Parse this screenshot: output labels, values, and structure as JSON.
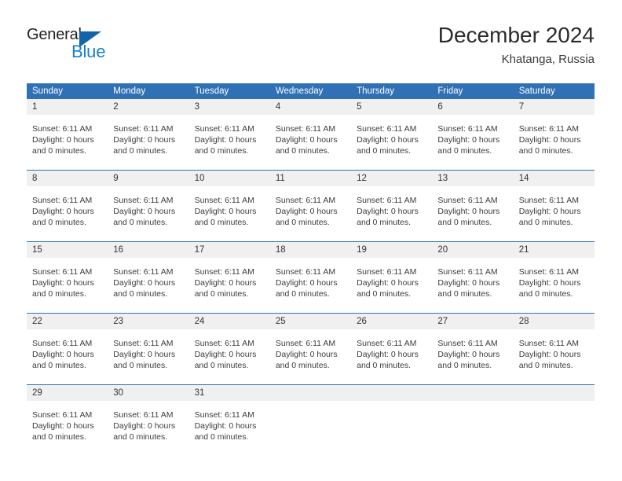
{
  "brand": {
    "name_part1": "General",
    "name_part2": "Blue",
    "triangle_icon": "triangle-right-icon",
    "colors": {
      "general_text": "#231f20",
      "blue_text": "#1a7fc8",
      "triangle": "#1464aa"
    }
  },
  "header": {
    "title": "December 2024",
    "location": "Khatanga, Russia"
  },
  "theme": {
    "header_bg": "#2f71b4",
    "header_text": "#ffffff",
    "date_band_bg": "#f0f0f0",
    "rule_color": "#2f71b4",
    "body_text": "#3c3c3c"
  },
  "calendar": {
    "weekdays": [
      "Sunday",
      "Monday",
      "Tuesday",
      "Wednesday",
      "Thursday",
      "Friday",
      "Saturday"
    ],
    "weeks": [
      {
        "days": [
          {
            "date": "1",
            "lines": [
              "Sunset: 6:11 AM",
              "Daylight: 0 hours",
              "and 0 minutes."
            ]
          },
          {
            "date": "2",
            "lines": [
              "Sunset: 6:11 AM",
              "Daylight: 0 hours",
              "and 0 minutes."
            ]
          },
          {
            "date": "3",
            "lines": [
              "Sunset: 6:11 AM",
              "Daylight: 0 hours",
              "and 0 minutes."
            ]
          },
          {
            "date": "4",
            "lines": [
              "Sunset: 6:11 AM",
              "Daylight: 0 hours",
              "and 0 minutes."
            ]
          },
          {
            "date": "5",
            "lines": [
              "Sunset: 6:11 AM",
              "Daylight: 0 hours",
              "and 0 minutes."
            ]
          },
          {
            "date": "6",
            "lines": [
              "Sunset: 6:11 AM",
              "Daylight: 0 hours",
              "and 0 minutes."
            ]
          },
          {
            "date": "7",
            "lines": [
              "Sunset: 6:11 AM",
              "Daylight: 0 hours",
              "and 0 minutes."
            ]
          }
        ]
      },
      {
        "days": [
          {
            "date": "8",
            "lines": [
              "Sunset: 6:11 AM",
              "Daylight: 0 hours",
              "and 0 minutes."
            ]
          },
          {
            "date": "9",
            "lines": [
              "Sunset: 6:11 AM",
              "Daylight: 0 hours",
              "and 0 minutes."
            ]
          },
          {
            "date": "10",
            "lines": [
              "Sunset: 6:11 AM",
              "Daylight: 0 hours",
              "and 0 minutes."
            ]
          },
          {
            "date": "11",
            "lines": [
              "Sunset: 6:11 AM",
              "Daylight: 0 hours",
              "and 0 minutes."
            ]
          },
          {
            "date": "12",
            "lines": [
              "Sunset: 6:11 AM",
              "Daylight: 0 hours",
              "and 0 minutes."
            ]
          },
          {
            "date": "13",
            "lines": [
              "Sunset: 6:11 AM",
              "Daylight: 0 hours",
              "and 0 minutes."
            ]
          },
          {
            "date": "14",
            "lines": [
              "Sunset: 6:11 AM",
              "Daylight: 0 hours",
              "and 0 minutes."
            ]
          }
        ]
      },
      {
        "days": [
          {
            "date": "15",
            "lines": [
              "Sunset: 6:11 AM",
              "Daylight: 0 hours",
              "and 0 minutes."
            ]
          },
          {
            "date": "16",
            "lines": [
              "Sunset: 6:11 AM",
              "Daylight: 0 hours",
              "and 0 minutes."
            ]
          },
          {
            "date": "17",
            "lines": [
              "Sunset: 6:11 AM",
              "Daylight: 0 hours",
              "and 0 minutes."
            ]
          },
          {
            "date": "18",
            "lines": [
              "Sunset: 6:11 AM",
              "Daylight: 0 hours",
              "and 0 minutes."
            ]
          },
          {
            "date": "19",
            "lines": [
              "Sunset: 6:11 AM",
              "Daylight: 0 hours",
              "and 0 minutes."
            ]
          },
          {
            "date": "20",
            "lines": [
              "Sunset: 6:11 AM",
              "Daylight: 0 hours",
              "and 0 minutes."
            ]
          },
          {
            "date": "21",
            "lines": [
              "Sunset: 6:11 AM",
              "Daylight: 0 hours",
              "and 0 minutes."
            ]
          }
        ]
      },
      {
        "days": [
          {
            "date": "22",
            "lines": [
              "Sunset: 6:11 AM",
              "Daylight: 0 hours",
              "and 0 minutes."
            ]
          },
          {
            "date": "23",
            "lines": [
              "Sunset: 6:11 AM",
              "Daylight: 0 hours",
              "and 0 minutes."
            ]
          },
          {
            "date": "24",
            "lines": [
              "Sunset: 6:11 AM",
              "Daylight: 0 hours",
              "and 0 minutes."
            ]
          },
          {
            "date": "25",
            "lines": [
              "Sunset: 6:11 AM",
              "Daylight: 0 hours",
              "and 0 minutes."
            ]
          },
          {
            "date": "26",
            "lines": [
              "Sunset: 6:11 AM",
              "Daylight: 0 hours",
              "and 0 minutes."
            ]
          },
          {
            "date": "27",
            "lines": [
              "Sunset: 6:11 AM",
              "Daylight: 0 hours",
              "and 0 minutes."
            ]
          },
          {
            "date": "28",
            "lines": [
              "Sunset: 6:11 AM",
              "Daylight: 0 hours",
              "and 0 minutes."
            ]
          }
        ]
      },
      {
        "days": [
          {
            "date": "29",
            "lines": [
              "Sunset: 6:11 AM",
              "Daylight: 0 hours",
              "and 0 minutes."
            ]
          },
          {
            "date": "30",
            "lines": [
              "Sunset: 6:11 AM",
              "Daylight: 0 hours",
              "and 0 minutes."
            ]
          },
          {
            "date": "31",
            "lines": [
              "Sunset: 6:11 AM",
              "Daylight: 0 hours",
              "and 0 minutes."
            ]
          },
          {
            "date": "",
            "lines": []
          },
          {
            "date": "",
            "lines": []
          },
          {
            "date": "",
            "lines": []
          },
          {
            "date": "",
            "lines": []
          }
        ]
      }
    ]
  }
}
